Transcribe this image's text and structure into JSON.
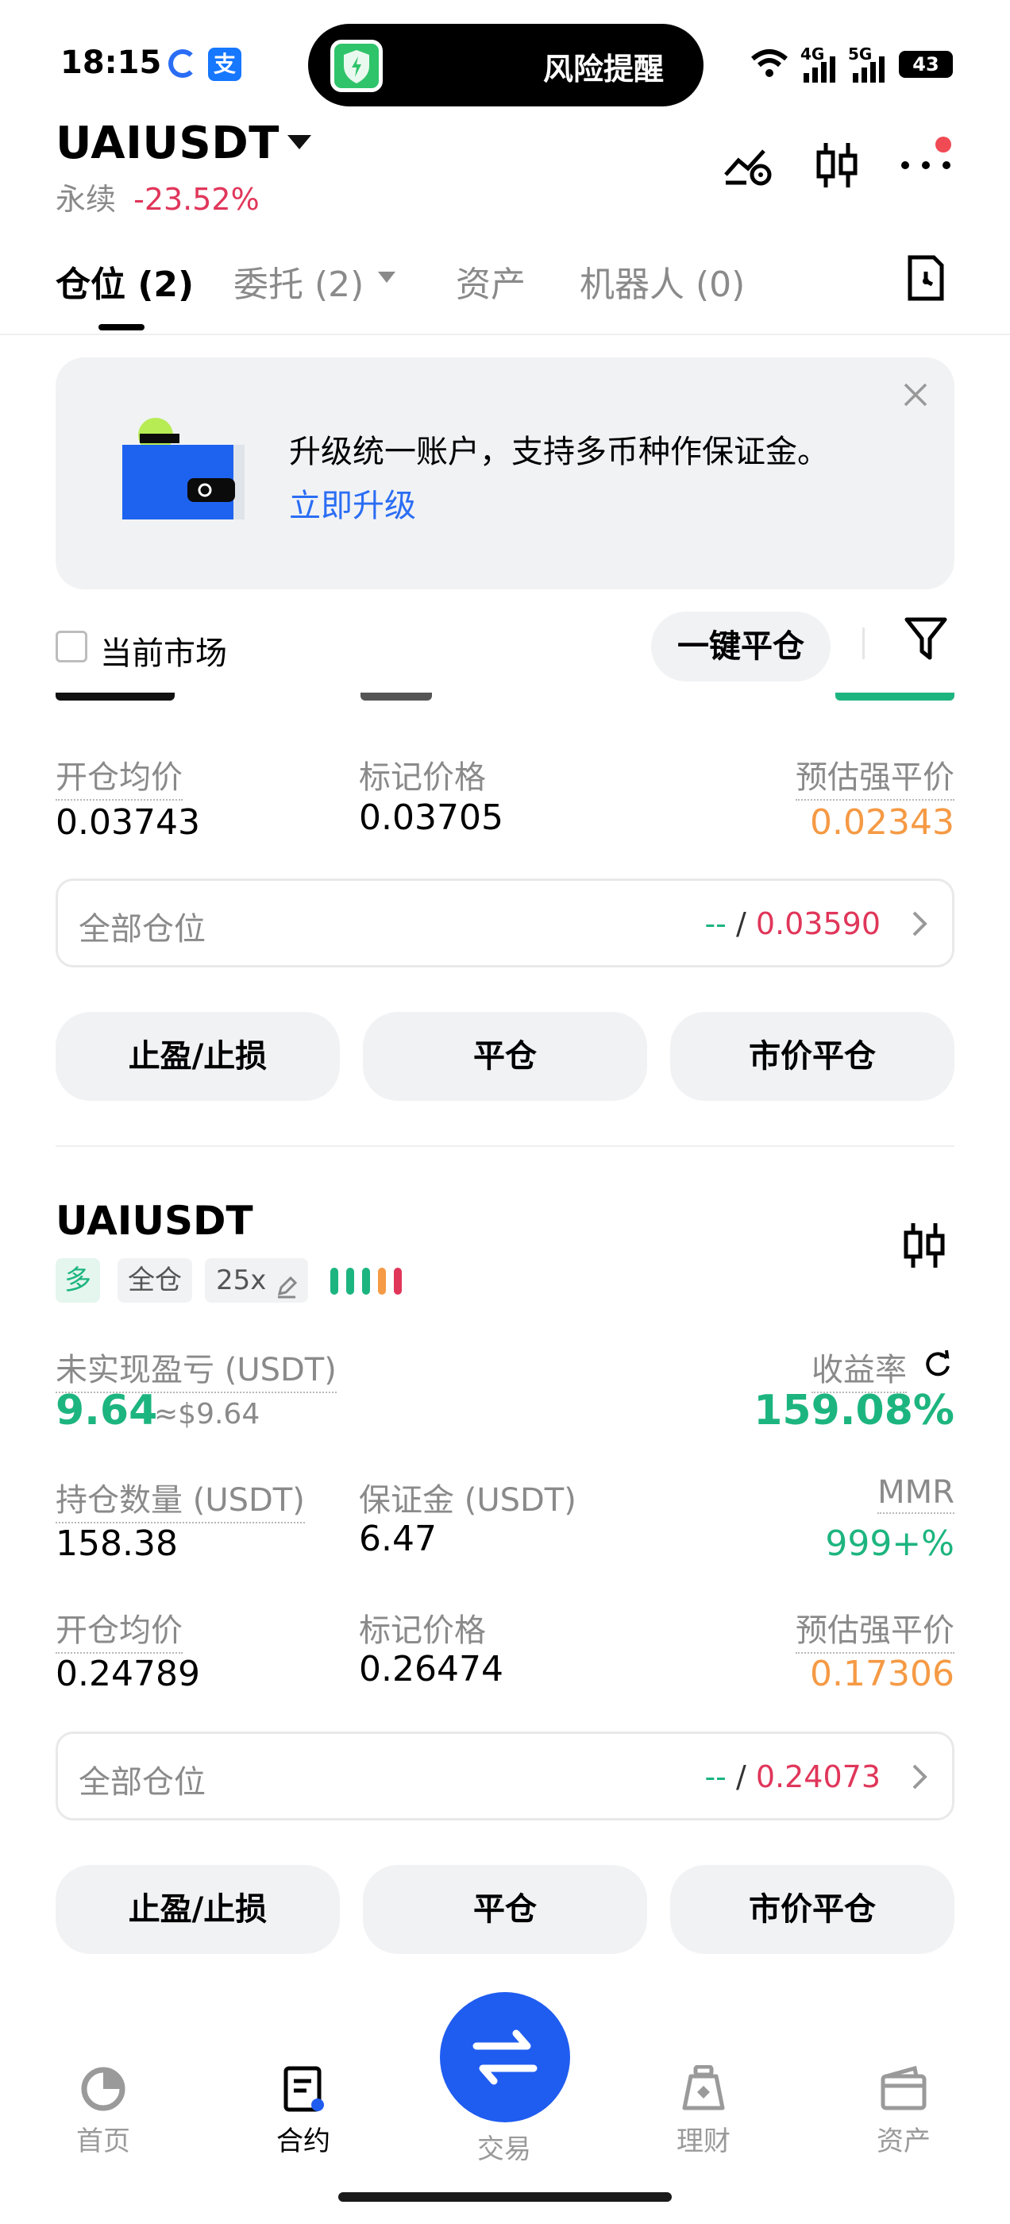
{
  "status_bar": {
    "time": "18:15",
    "island_text": "风险提醒",
    "signal_4g": "4G",
    "signal_5g": "5G",
    "battery": "43"
  },
  "header": {
    "symbol": "UAIUSDT",
    "type": "永续",
    "change": "-23.52%"
  },
  "tabs": [
    {
      "label": "仓位 (2)"
    },
    {
      "label": "委托 (2)"
    },
    {
      "label": "资产"
    },
    {
      "label": "机器人 (0)"
    }
  ],
  "banner": {
    "text": "升级统一账户，支持多币种作保证金。",
    "link": "立即升级"
  },
  "filters": {
    "current_market": "当前市场",
    "close_all": "一键平仓"
  },
  "positions": [
    {
      "avg_open_label": "开仓均价",
      "avg_open": "0.03743",
      "mark_price_label": "标记价格",
      "mark_price": "0.03705",
      "liq_price_label": "预估强平价",
      "liq_price": "0.02343",
      "all_positions_label": "全部仓位",
      "tp_value": "--",
      "sl_value": "0.03590",
      "buttons": [
        "止盈/止损",
        "平仓",
        "市价平仓"
      ]
    },
    {
      "symbol": "UAIUSDT",
      "side": "多",
      "margin_mode": "全仓",
      "leverage": "25x",
      "upnl_label": "未实现盈亏 (USDT)",
      "upnl": "9.64",
      "upnl_usd": "≈$9.64",
      "roe_label": "收益率",
      "roe": "159.08%",
      "size_label": "持仓数量 (USDT)",
      "size": "158.38",
      "margin_label": "保证金 (USDT)",
      "margin": "6.47",
      "mmr_label": "MMR",
      "mmr": "999+%",
      "avg_open_label": "开仓均价",
      "avg_open": "0.24789",
      "mark_price_label": "标记价格",
      "mark_price": "0.26474",
      "liq_price_label": "预估强平价",
      "liq_price": "0.17306",
      "all_positions_label": "全部仓位",
      "tp_value": "--",
      "sl_value": "0.24073",
      "buttons": [
        "止盈/止损",
        "平仓",
        "市价平仓"
      ]
    }
  ],
  "bottom_nav": [
    {
      "label": "首页",
      "icon": "home-icon"
    },
    {
      "label": "合约",
      "icon": "contract-icon"
    },
    {
      "label": "交易",
      "icon": "swap-icon"
    },
    {
      "label": "理财",
      "icon": "finance-icon"
    },
    {
      "label": "资产",
      "icon": "wallet-icon"
    }
  ],
  "colors": {
    "green": "#1db57f",
    "red": "#e0365a",
    "orange": "#f59a45",
    "accent": "#1f5cf0"
  }
}
